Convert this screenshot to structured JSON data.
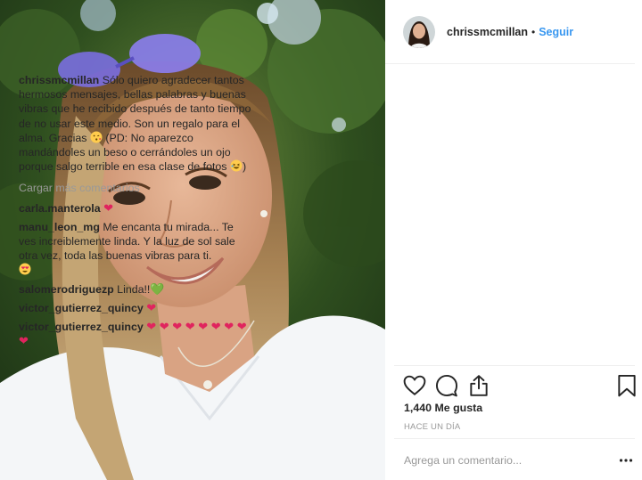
{
  "post": {
    "username": "chrissmcmillan",
    "separator": "•",
    "follow_label": "Seguir",
    "caption": "Sólo quiero agradecer tantos hermosos mensajes, bellas palabras y buenas vibras que he recibido después de tanto tiempo de no usar este medio. Son un regalo para el alma. Gracias",
    "caption_2": "(PD: No aparezco mandándoles un beso o cerrándoles un ojo porque salgo terrible en esa clase de fotos",
    "caption_end": ")"
  },
  "comments": {
    "load_more": "Cargar más comentarios",
    "items": [
      {
        "user": "carla.manterola",
        "text": "",
        "hearts": "❤"
      },
      {
        "user": "manu_leon_mg",
        "text": "Me encanta tu mirada... Te ves increiblemente linda. Y la luz de sol sale otra vez, toda las buenas vibras para ti."
      },
      {
        "user": "salomerodriguezp",
        "text": "Linda!!",
        "hearts": "💚"
      },
      {
        "user": "victor_gutierrez_quincy",
        "text": "",
        "hearts": "❤"
      },
      {
        "user": "victor_gutierrez_quincy",
        "text": "",
        "hearts": "❤ ❤ ❤ ❤ ❤ ❤ ❤ ❤ ❤"
      }
    ]
  },
  "stats": {
    "likes": "1,440 Me gusta",
    "time": "HACE UN DÍA"
  },
  "composer": {
    "placeholder": "Agrega un comentario...",
    "more_glyph": "..."
  },
  "icons": {
    "like": "heart-outline-icon",
    "comment": "speech-bubble-icon",
    "share": "share-icon",
    "save": "bookmark-icon",
    "more": "more-options-icon"
  },
  "colors": {
    "link": "#3897f0",
    "heart": "#e0245e",
    "muted": "#999999"
  }
}
